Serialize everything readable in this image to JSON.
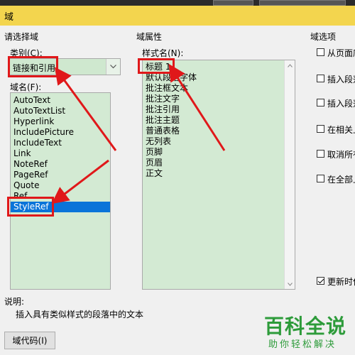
{
  "window": {
    "title": "域"
  },
  "left": {
    "group_label": "请选择域",
    "category_label": "类别(C):",
    "category_value": "链接和引用",
    "names_label": "域名(F):",
    "field_names": [
      "AutoText",
      "AutoTextList",
      "Hyperlink",
      "IncludePicture",
      "IncludeText",
      "Link",
      "NoteRef",
      "PageRef",
      "Quote",
      "Ref",
      "StyleRef"
    ],
    "selected_field": "StyleRef"
  },
  "middle": {
    "group_label": "域属性",
    "style_label": "样式名(N):",
    "styles": [
      "标题 1",
      "默认段落字体",
      "批注框文本",
      "批注文字",
      "批注引用",
      "批注主题",
      "普通表格",
      "无列表",
      "页脚",
      "页眉",
      "正文"
    ]
  },
  "right": {
    "group_label": "域选项",
    "options": [
      {
        "label": "从页面底",
        "checked": false
      },
      {
        "label": "插入段落",
        "checked": false
      },
      {
        "label": "插入段落",
        "checked": false
      },
      {
        "label": "在相关上",
        "checked": false
      },
      {
        "label": "取消所有",
        "checked": false
      },
      {
        "label": "在全部上",
        "checked": false
      }
    ],
    "update_option": {
      "label": "更新时保",
      "checked": true
    }
  },
  "description": {
    "label": "说明:",
    "text": "插入具有类似样式的段落中的文本"
  },
  "buttons": {
    "field_codes": "域代码(I)"
  },
  "watermark": {
    "big": "百科全说",
    "small": "助你轻松解决"
  },
  "colors": {
    "title_bar": "#f3d54e",
    "list_bg": "#d3ead3",
    "selection": "#0a74d9",
    "annotation": "#e0181a",
    "brand_green": "#2d9b3a"
  }
}
